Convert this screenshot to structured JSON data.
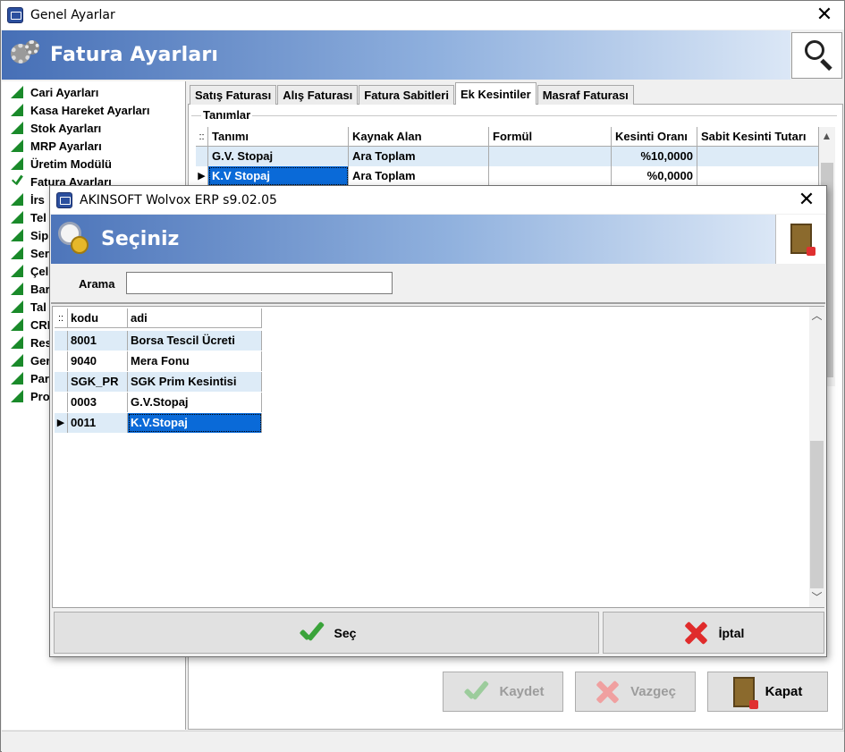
{
  "main_window": {
    "title": "Genel Ayarlar",
    "close_glyph": "✕",
    "banner_title": "Fatura Ayarları",
    "search_icon": "magnifier-icon"
  },
  "sidebar": {
    "items": [
      {
        "label": "Cari Ayarları",
        "icon": "triangle"
      },
      {
        "label": "Kasa Hareket Ayarları",
        "icon": "triangle"
      },
      {
        "label": "Stok Ayarları",
        "icon": "triangle"
      },
      {
        "label": "MRP Ayarları",
        "icon": "triangle"
      },
      {
        "label": "Üretim Modülü",
        "icon": "triangle"
      },
      {
        "label": "Fatura Ayarları",
        "icon": "check"
      },
      {
        "label": "İrs",
        "icon": "triangle"
      },
      {
        "label": "Tel",
        "icon": "triangle"
      },
      {
        "label": "Sip",
        "icon": "triangle"
      },
      {
        "label": "Ser",
        "icon": "triangle"
      },
      {
        "label": "Çel",
        "icon": "triangle"
      },
      {
        "label": "Bar",
        "icon": "triangle"
      },
      {
        "label": "Tal",
        "icon": "triangle"
      },
      {
        "label": "CRI",
        "icon": "triangle"
      },
      {
        "label": "Res",
        "icon": "triangle"
      },
      {
        "label": "Ger",
        "icon": "triangle"
      },
      {
        "label": "Par",
        "icon": "triangle"
      },
      {
        "label": "Pro",
        "icon": "triangle"
      }
    ]
  },
  "tabs": [
    {
      "label": "Satış Faturası"
    },
    {
      "label": "Alış Faturası"
    },
    {
      "label": "Fatura Sabitleri"
    },
    {
      "label": "Ek Kesintiler"
    },
    {
      "label": "Masraf Faturası"
    }
  ],
  "active_tab": "Ek Kesintiler",
  "group": {
    "title": "Tanımlar"
  },
  "kesinti_grid": {
    "indicator_header": "::",
    "columns": [
      "Tanımı",
      "Kaynak Alan",
      "Formül",
      "Kesinti Oranı",
      "Sabit Kesinti Tutarı"
    ],
    "rows": [
      {
        "tanimi": "G.V. Stopaj",
        "kaynak": "Ara Toplam",
        "formul": "",
        "oran": "%10,0000",
        "sabit": ""
      },
      {
        "tanimi": "K.V Stopaj",
        "kaynak": "Ara Toplam",
        "formul": "",
        "oran": "%0,0000",
        "sabit": ""
      }
    ]
  },
  "bottom_buttons": {
    "kaydet": "Kaydet",
    "vazgec": "Vazgeç",
    "kapat": "Kapat"
  },
  "dialog": {
    "title": "AKINSOFT Wolvox ERP s9.02.05",
    "close_glyph": "✕",
    "banner_title": "Seçiniz",
    "search_label": "Arama",
    "search_value": "",
    "grid": {
      "indicator_header": "::",
      "columns": [
        "kodu",
        "adi"
      ],
      "rows": [
        {
          "kodu": "8001",
          "adi": "Borsa Tescil Ücreti"
        },
        {
          "kodu": "9040",
          "adi": "Mera Fonu"
        },
        {
          "kodu": "SGK_PR",
          "adi": "SGK Prim Kesintisi"
        },
        {
          "kodu": "0003",
          "adi": "G.V.Stopaj"
        },
        {
          "kodu": "0011",
          "adi": "K.V.Stopaj"
        }
      ],
      "selected_row": "0011"
    },
    "buttons": {
      "sec": "Seç",
      "iptal": "İptal"
    }
  },
  "colors": {
    "banner_start": "#466fb6",
    "selection": "#0a6ad8",
    "row_highlight": "#ddebf7",
    "tree_icon": "#1a8a2a"
  }
}
